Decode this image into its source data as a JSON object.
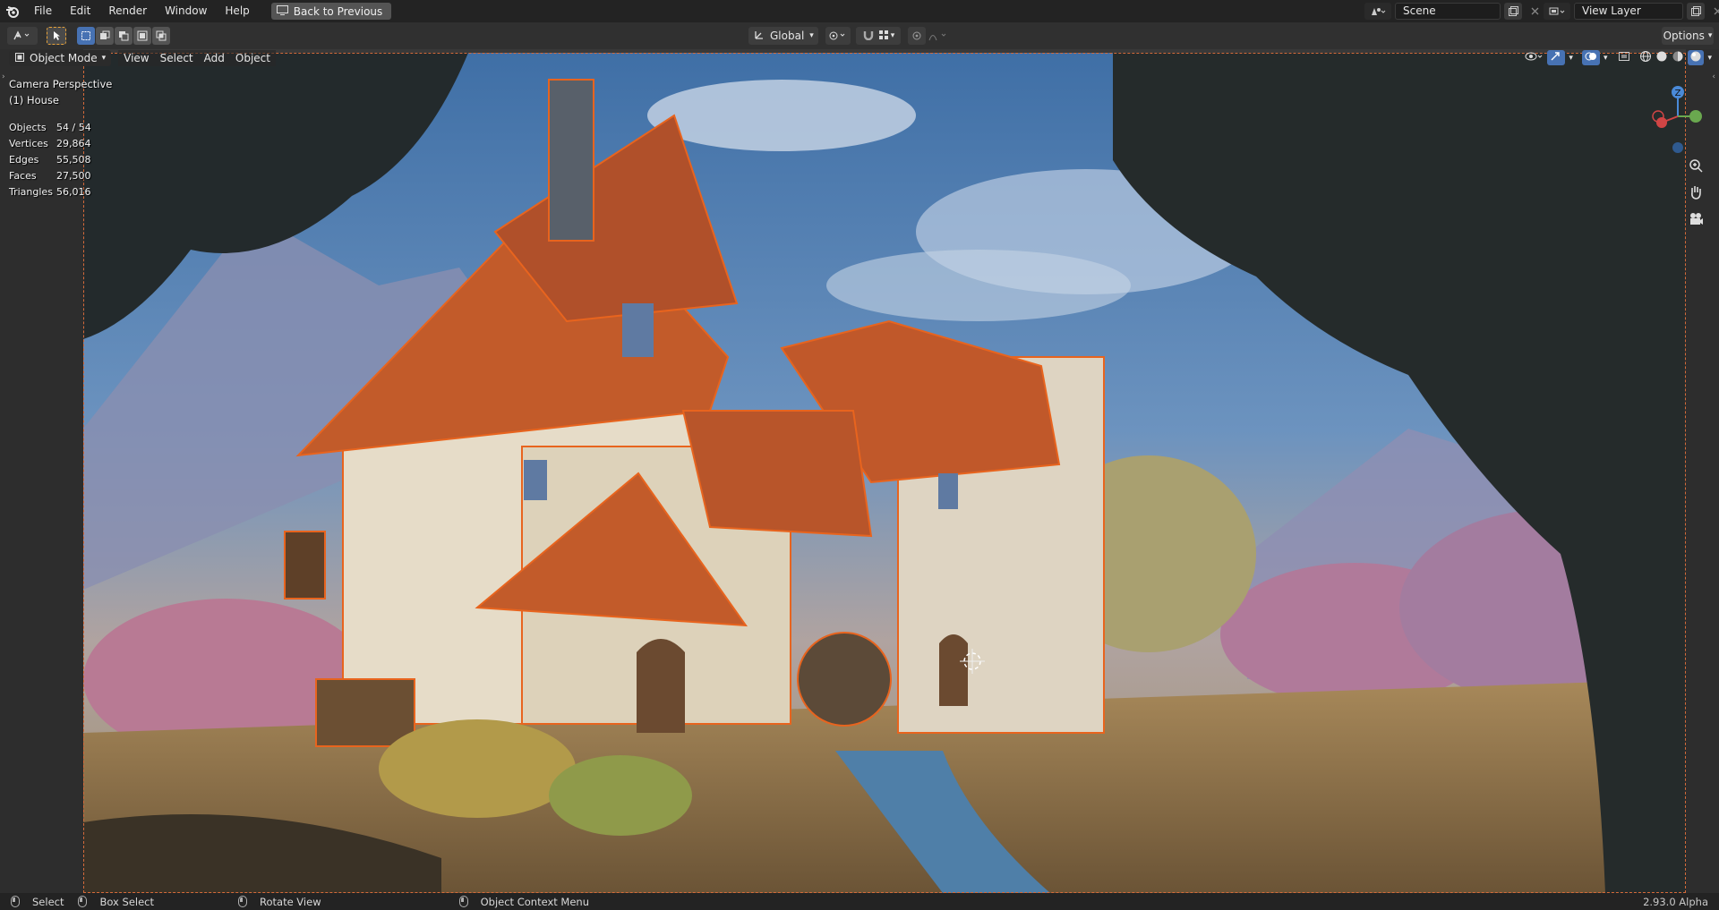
{
  "topbar": {
    "menus": [
      "File",
      "Edit",
      "Render",
      "Window",
      "Help"
    ],
    "back_label": "Back to Previous",
    "scene_name": "Scene",
    "view_layer": "View Layer"
  },
  "toolheader": {
    "orientation": "Global",
    "options_label": "Options"
  },
  "viewport": {
    "mode": "Object Mode",
    "menus": [
      "View",
      "Select",
      "Add",
      "Object"
    ],
    "camera_label": "Camera Perspective",
    "object_label": "(1) House",
    "stats": [
      {
        "label": "Objects",
        "value": "54 / 54"
      },
      {
        "label": "Vertices",
        "value": "29,864"
      },
      {
        "label": "Edges",
        "value": "55,508"
      },
      {
        "label": "Faces",
        "value": "27,500"
      },
      {
        "label": "Triangles",
        "value": "56,016"
      }
    ],
    "gizmo_axis_label": "Z"
  },
  "statusbar": {
    "select": "Select",
    "box_select": "Box Select",
    "rotate_view": "Rotate View",
    "context_menu": "Object Context Menu",
    "version": "2.93.0 Alpha"
  },
  "colors": {
    "accent_orange": "#e8641e",
    "camera_frame": "#d46a3a",
    "topbar_bg": "#232323",
    "header_bg": "#303030"
  }
}
